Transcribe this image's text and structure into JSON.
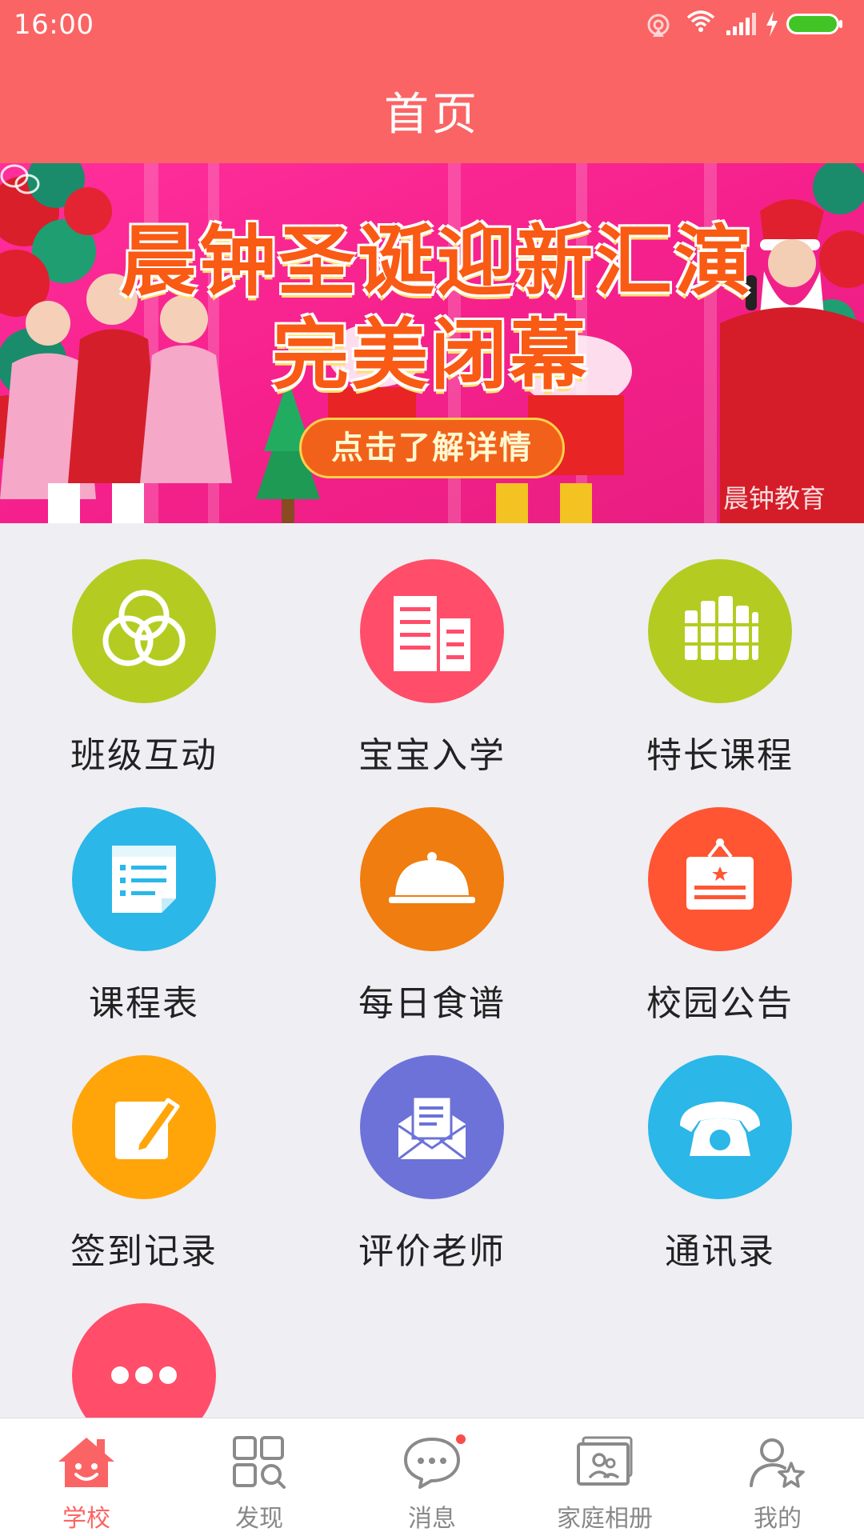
{
  "status_bar": {
    "time": "16:00"
  },
  "header": {
    "title": "首页"
  },
  "banner": {
    "title_line1": "晨钟圣诞迎新汇演",
    "title_line2": "完美闭幕",
    "button_label": "点击了解详情",
    "watermark": "晨钟教育"
  },
  "grid": {
    "items": [
      {
        "label": "班级互动",
        "icon": "rings-icon",
        "color": "#b4cc21"
      },
      {
        "label": "宝宝入学",
        "icon": "building-icon",
        "color": "#ff4d6a"
      },
      {
        "label": "特长课程",
        "icon": "books-icon",
        "color": "#b4cc21"
      },
      {
        "label": "课程表",
        "icon": "schedule-list-icon",
        "color": "#2bb7e8"
      },
      {
        "label": "每日食谱",
        "icon": "food-cloche-icon",
        "color": "#f07d0f"
      },
      {
        "label": "校园公告",
        "icon": "notice-board-icon",
        "color": "#ff5533"
      },
      {
        "label": "签到记录",
        "icon": "edit-pencil-icon",
        "color": "#ffa50a"
      },
      {
        "label": "评价老师",
        "icon": "envelope-letter-icon",
        "color": "#6c72d8"
      },
      {
        "label": "通讯录",
        "icon": "telephone-icon",
        "color": "#2bb7e8"
      },
      {
        "label": "",
        "icon": "more-dots-icon",
        "color": "#ff4d6a"
      }
    ]
  },
  "tabbar": {
    "active": "学校",
    "active_color": "#fb6464",
    "tabs": [
      {
        "label": "学校",
        "icon": "school-house-icon"
      },
      {
        "label": "发现",
        "icon": "discover-grid-icon"
      },
      {
        "label": "消息",
        "icon": "message-bubble-icon",
        "has_badge": true
      },
      {
        "label": "家庭相册",
        "icon": "photo-album-icon"
      },
      {
        "label": "我的",
        "icon": "profile-star-icon"
      }
    ]
  }
}
